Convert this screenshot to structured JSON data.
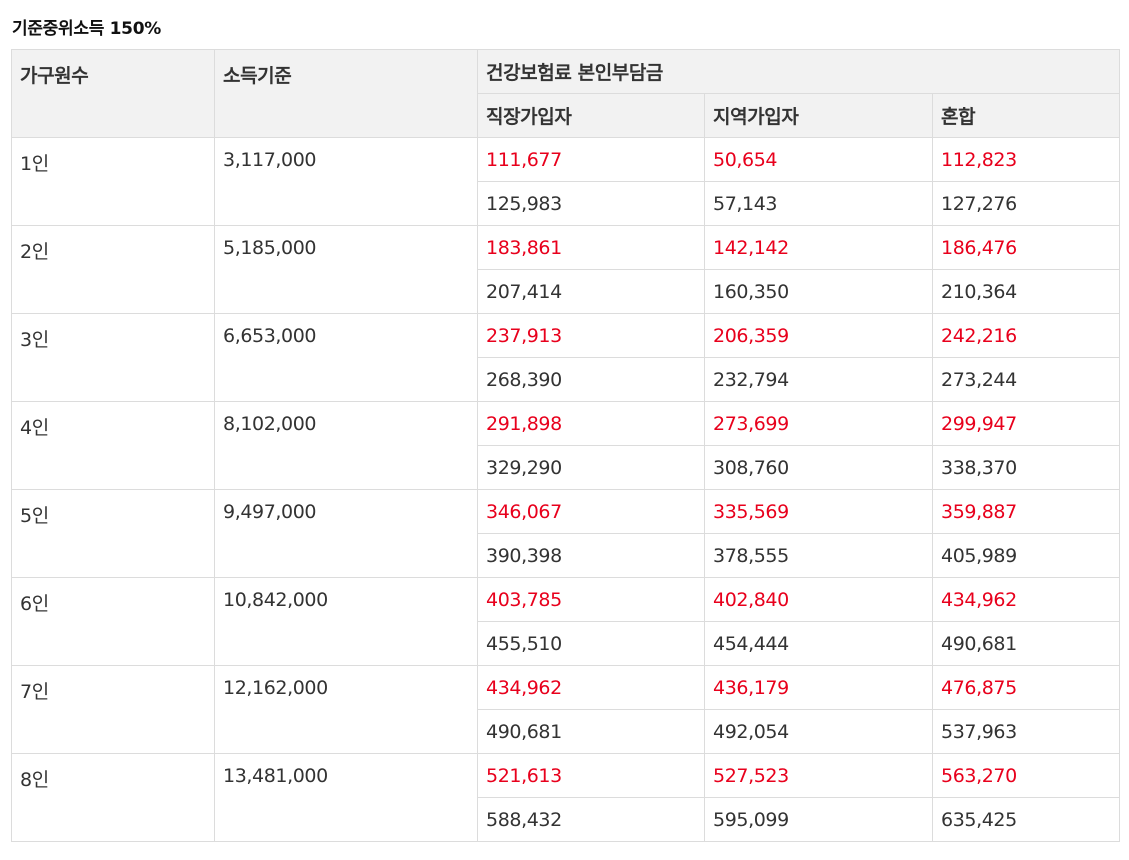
{
  "title": "기준중위소득 150%",
  "headers": {
    "household": "가구원수",
    "income": "소득기준",
    "premium_group": "건강보험료 본인부담금",
    "workplace": "직장가입자",
    "regional": "지역가입자",
    "mixed": "혼합"
  },
  "accent_color": "#e8001c",
  "rows": [
    {
      "household": "1인",
      "income": "3,117,000",
      "red": [
        "111,677",
        "50,654",
        "112,823"
      ],
      "black": [
        "125,983",
        "57,143",
        "127,276"
      ]
    },
    {
      "household": "2인",
      "income": "5,185,000",
      "red": [
        "183,861",
        "142,142",
        "186,476"
      ],
      "black": [
        "207,414",
        "160,350",
        "210,364"
      ]
    },
    {
      "household": "3인",
      "income": "6,653,000",
      "red": [
        "237,913",
        "206,359",
        "242,216"
      ],
      "black": [
        "268,390",
        "232,794",
        "273,244"
      ]
    },
    {
      "household": "4인",
      "income": "8,102,000",
      "red": [
        "291,898",
        "273,699",
        "299,947"
      ],
      "black": [
        "329,290",
        "308,760",
        "338,370"
      ]
    },
    {
      "household": "5인",
      "income": "9,497,000",
      "red": [
        "346,067",
        "335,569",
        "359,887"
      ],
      "black": [
        "390,398",
        "378,555",
        "405,989"
      ]
    },
    {
      "household": "6인",
      "income": "10,842,000",
      "red": [
        "403,785",
        "402,840",
        "434,962"
      ],
      "black": [
        "455,510",
        "454,444",
        "490,681"
      ]
    },
    {
      "household": "7인",
      "income": "12,162,000",
      "red": [
        "434,962",
        "436,179",
        "476,875"
      ],
      "black": [
        "490,681",
        "492,054",
        "537,963"
      ]
    },
    {
      "household": "8인",
      "income": "13,481,000",
      "red": [
        "521,613",
        "527,523",
        "563,270"
      ],
      "black": [
        "588,432",
        "595,099",
        "635,425"
      ]
    }
  ]
}
